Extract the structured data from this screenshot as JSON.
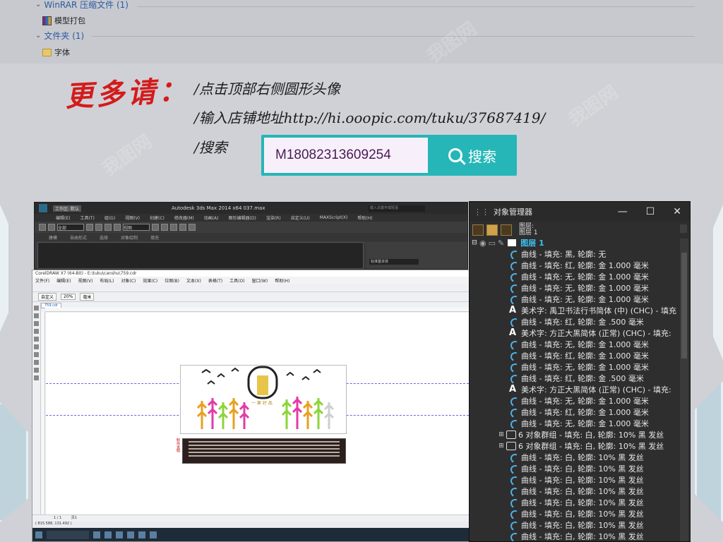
{
  "explorer": {
    "groups": [
      {
        "label": "WinRAR 压缩文件 (1)",
        "files": [
          "模型打包"
        ]
      },
      {
        "label": "文件夹 (1)",
        "files": [
          "字体"
        ]
      }
    ]
  },
  "promo": {
    "heading": "更多请：",
    "line1": "/点击顶部右侧圆形头像",
    "line2": "/输入店铺地址http://hi.ooopic.com/tuku/37687419/",
    "line3": "/搜索",
    "search_value": "M18082313609254",
    "search_button": "搜索"
  },
  "max": {
    "title": "Autodesk 3ds Max  2014 x64      037.max",
    "workspace": "工作区: 默认",
    "help_placeholder": "键入关键字或短语",
    "menus": [
      "编辑(E)",
      "工具(T)",
      "组(G)",
      "视图(V)",
      "创建(C)",
      "修改器(M)",
      "动画(A)",
      "图形编辑器(D)",
      "渲染(R)",
      "自定义(U)",
      "MAXScript(X)",
      "帮助(H)"
    ],
    "toolbar_select": "全部",
    "toolbar_view": "视图",
    "ribbon": [
      "建模",
      "自由形式",
      "选择",
      "对象绘制",
      "填充"
    ],
    "side_select": "标准基本体"
  },
  "corel": {
    "title": "CorelDRAW X7 (64-Bit) - E:\\tuku\\canshu\\759.cdr",
    "menus": [
      "文件(F)",
      "编辑(E)",
      "视图(V)",
      "布局(L)",
      "对象(C)",
      "效果(C)",
      "位图(B)",
      "文本(X)",
      "表格(T)",
      "工具(O)",
      "窗口(W)",
      "帮助(H)"
    ],
    "zoom": "20%",
    "units": "毫米",
    "preset": "自定义",
    "tab": "759.cdr",
    "design_label": "一 果 好 品",
    "design_side": "制作说明",
    "page_nav": "1 / 1",
    "page_tab": "页1",
    "status_coords": "( 815.588, 131.492 )"
  },
  "object_manager": {
    "title": "对象管理器",
    "layer_header_1": "图层:",
    "layer_header_2": "图层 1",
    "layer_name": "图层 1",
    "rows": [
      {
        "type": "curve",
        "text": "曲线 - 填充: 黑, 轮廓: 无"
      },
      {
        "type": "curve",
        "text": "曲线 - 填充: 红, 轮廓: 金  1.000 毫米"
      },
      {
        "type": "curve",
        "text": "曲线 - 填充: 无, 轮廓: 金  1.000 毫米"
      },
      {
        "type": "curve",
        "text": "曲线 - 填充: 无, 轮廓: 金  1.000 毫米"
      },
      {
        "type": "curve",
        "text": "曲线 - 填充: 无, 轮廓: 金  1.000 毫米"
      },
      {
        "type": "text",
        "text": "美术字: 禹卫书法行书简体 (中) (CHC) - 填充"
      },
      {
        "type": "curve",
        "text": "曲线 - 填充: 红, 轮廓: 金  .500 毫米"
      },
      {
        "type": "text",
        "text": "美术字: 方正大黑简体 (正常) (CHC) - 填充:"
      },
      {
        "type": "curve",
        "text": "曲线 - 填充: 无, 轮廓: 金  1.000 毫米"
      },
      {
        "type": "curve",
        "text": "曲线 - 填充: 红, 轮廓: 金  1.000 毫米"
      },
      {
        "type": "curve",
        "text": "曲线 - 填充: 无, 轮廓: 金  1.000 毫米"
      },
      {
        "type": "curve",
        "text": "曲线 - 填充: 红, 轮廓: 金  .500 毫米"
      },
      {
        "type": "text",
        "text": "美术字: 方正大黑简体 (正常) (CHC) - 填充:"
      },
      {
        "type": "curve",
        "text": "曲线 - 填充: 无, 轮廓: 金  1.000 毫米"
      },
      {
        "type": "curve",
        "text": "曲线 - 填充: 红, 轮廓: 金  1.000 毫米"
      },
      {
        "type": "curve",
        "text": "曲线 - 填充: 无, 轮廓: 金  1.000 毫米"
      },
      {
        "type": "group",
        "text": "6 对象群组 - 填充: 白, 轮廓: 10% 黑 发丝"
      },
      {
        "type": "group",
        "text": "6 对象群组 - 填充: 白, 轮廓: 10% 黑 发丝"
      },
      {
        "type": "curve",
        "text": "曲线 - 填充: 白, 轮廓: 10% 黑 发丝"
      },
      {
        "type": "curve",
        "text": "曲线 - 填充: 白, 轮廓: 10% 黑 发丝"
      },
      {
        "type": "curve",
        "text": "曲线 - 填充: 白, 轮廓: 10% 黑 发丝"
      },
      {
        "type": "curve",
        "text": "曲线 - 填充: 白, 轮廓: 10% 黑 发丝"
      },
      {
        "type": "curve",
        "text": "曲线 - 填充: 白, 轮廓: 10% 黑 发丝"
      },
      {
        "type": "curve",
        "text": "曲线 - 填充: 白, 轮廓: 10% 黑 发丝"
      },
      {
        "type": "curve",
        "text": "曲线 - 填充: 白, 轮廓: 10% 黑 发丝"
      },
      {
        "type": "curve",
        "text": "曲线 - 填充: 白, 轮廓: 10% 黑 发丝"
      }
    ]
  },
  "colors": {
    "accent": "#26b6b8",
    "promo_red": "#d41b1b",
    "layer_blue": "#3cc0f0"
  }
}
